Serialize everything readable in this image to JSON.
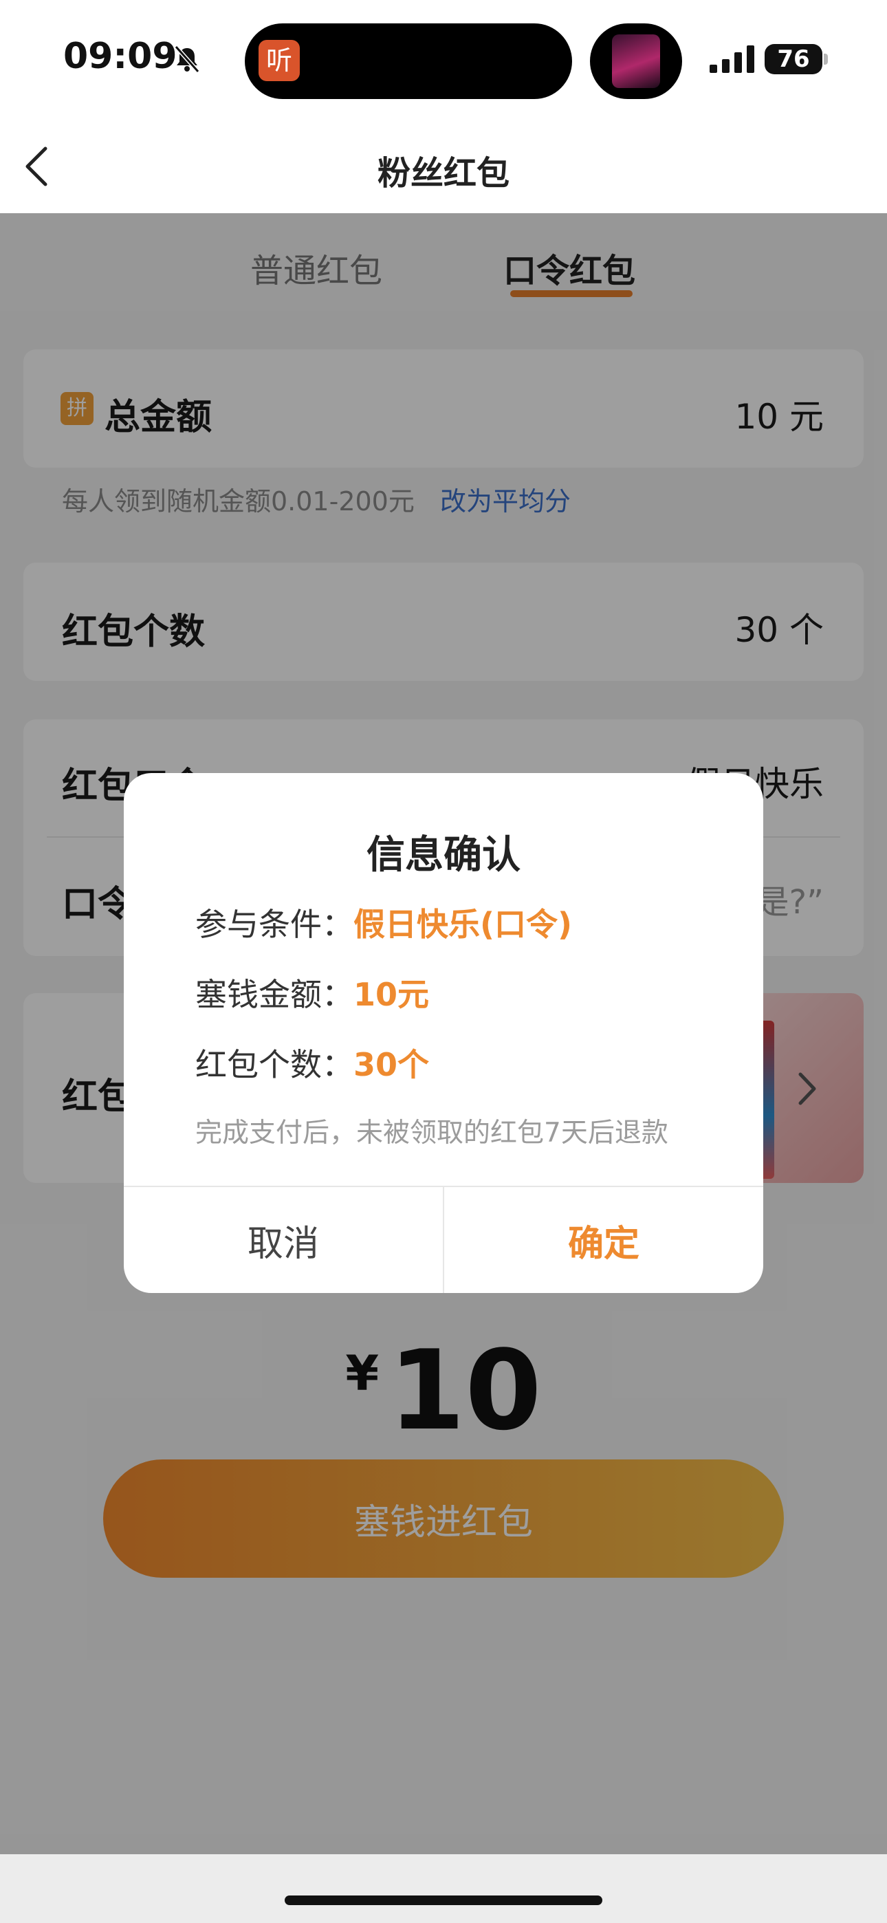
{
  "status_bar": {
    "time": "09:09",
    "island_app_label": "听",
    "battery": "76"
  },
  "nav": {
    "title": "粉丝红包"
  },
  "tabs": [
    {
      "label": "普通红包",
      "active": false
    },
    {
      "label": "口令红包",
      "active": true
    }
  ],
  "form": {
    "total": {
      "icon_label": "拼",
      "label": "总金额",
      "value": "10 元"
    },
    "hint": {
      "text": "每人领到随机金额0.01-200元",
      "link": "改为平均分"
    },
    "count": {
      "label": "红包个数",
      "value": "30 个"
    },
    "code": {
      "label": "红包口令",
      "value": "假日快乐",
      "label_2": "口令",
      "value_2": "是?”"
    },
    "cover": {
      "label": "红包"
    }
  },
  "amount": {
    "currency": "¥",
    "value": "10"
  },
  "pay_button": {
    "label": "塞钱进红包"
  },
  "dialog": {
    "title": "信息确认",
    "rows": [
      {
        "key": "参与条件：",
        "value": "假日快乐(口令)"
      },
      {
        "key": "塞钱金额：",
        "value": "10元"
      },
      {
        "key": "红包个数：",
        "value": "30个"
      }
    ],
    "note": "完成支付后，未被领取的红包7天后退款",
    "cancel": "取消",
    "confirm": "确定"
  },
  "colors": {
    "accent": "#ee8a2f",
    "link": "#3a6fc8",
    "overlay": "rgba(0,0,0,0.38)"
  },
  "icons": [
    "bell-slash-icon",
    "back-icon",
    "chevron-right-icon",
    "signal-icon",
    "battery-icon"
  ]
}
